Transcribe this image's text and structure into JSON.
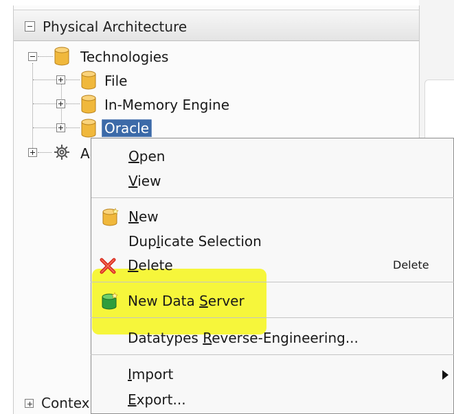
{
  "panel": {
    "title": "Physical Architecture",
    "bottom_section_label": "Contex"
  },
  "tree": {
    "root_label": "Technologies",
    "children": [
      {
        "label": "File"
      },
      {
        "label": "In-Memory Engine"
      },
      {
        "label": "Oracle"
      }
    ],
    "agents_label_partial": "A"
  },
  "menu": {
    "items": [
      {
        "key": "open",
        "pre": "",
        "mn": "O",
        "post": "pen"
      },
      {
        "key": "view",
        "pre": "",
        "mn": "V",
        "post": "iew"
      },
      {
        "key": "new",
        "pre": "",
        "mn": "N",
        "post": "ew"
      },
      {
        "key": "duplicate",
        "pre": "Dup",
        "mn": "l",
        "post": "icate Selection"
      },
      {
        "key": "delete",
        "pre": "",
        "mn": "D",
        "post": "elete",
        "shortcut": "Delete"
      },
      {
        "key": "new_data_server",
        "pre": "New Data ",
        "mn": "S",
        "post": "erver"
      },
      {
        "key": "datatypes",
        "pre": "Datatypes ",
        "mn": "R",
        "post": "everse-Engineering..."
      },
      {
        "key": "import",
        "pre": "",
        "mn": "I",
        "post": "mport"
      },
      {
        "key": "export",
        "pre": "",
        "mn": "E",
        "post": "xport..."
      }
    ]
  },
  "colors": {
    "selection": "#3c6aa8",
    "highlight": "#f5f52a",
    "cylinder": "#f0b83c",
    "green_cylinder": "#2f9e3c",
    "delete_x": "#d8261c"
  }
}
